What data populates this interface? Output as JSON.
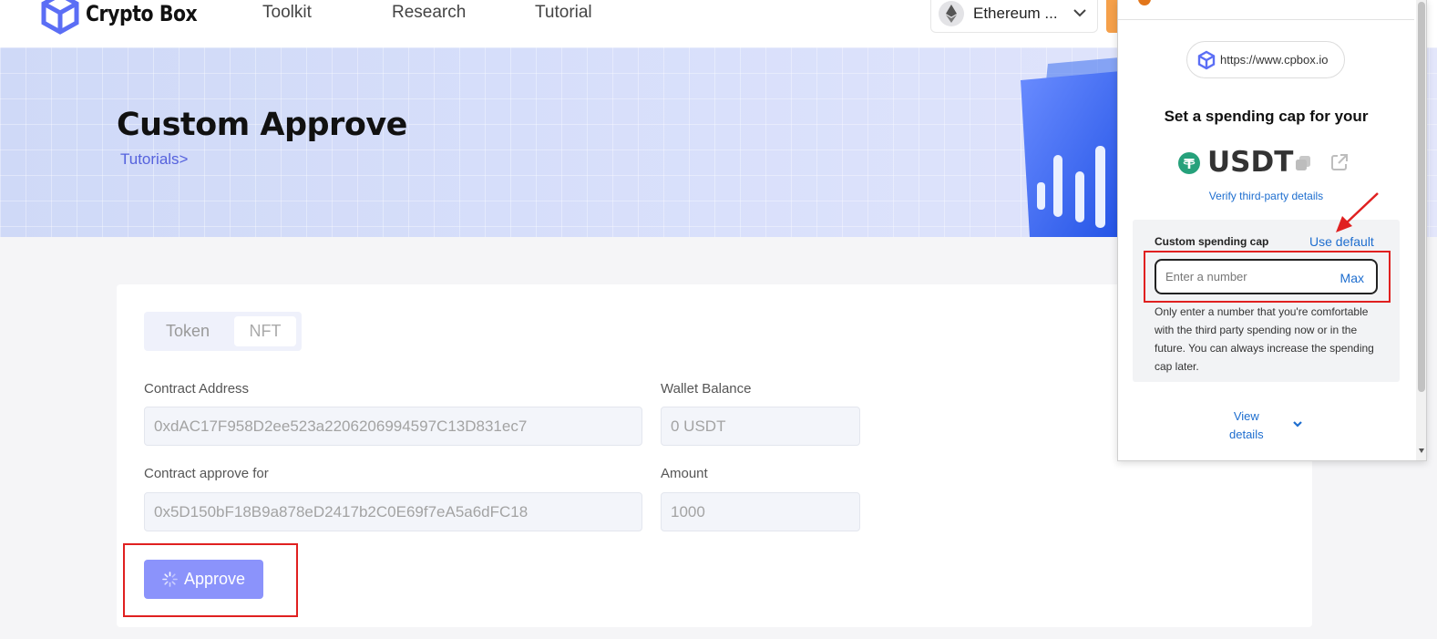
{
  "nav": {
    "brand": "Crypto Box",
    "links": [
      "Toolkit",
      "Research",
      "Tutorial"
    ],
    "network": "Ethereum ..."
  },
  "banner": {
    "title": "Custom Approve",
    "breadcrumb": "Tutorials>"
  },
  "form": {
    "tabs": [
      "Token",
      "NFT"
    ],
    "contract_address_label": "Contract Address",
    "contract_address_value": "0xdAC17F958D2ee523a2206206994597C13D831ec7",
    "wallet_balance_label": "Wallet Balance",
    "wallet_balance_value": "0 USDT",
    "approve_for_label": "Contract approve for",
    "approve_for_value": "0x5D150bF18B9a878eD2417b2C0E69f7eA5a6dFC18",
    "amount_label": "Amount",
    "amount_value": "1000",
    "approve_button": "Approve"
  },
  "wallet_popup": {
    "site_url": "https://www.cpbox.io",
    "heading": "Set a spending cap for your",
    "token_symbol": "USDT",
    "verify_link": "Verify third-party details",
    "cap_label": "Custom spending cap",
    "use_default": "Use default",
    "input_placeholder": "Enter a number",
    "max_label": "Max",
    "help_text": "Only enter a number that you're comfortable with the third party spending now or in the future. You can always increase the spending cap later.",
    "view_details_line1": "View",
    "view_details_line2": "details"
  },
  "colors": {
    "accent": "#8b93fb",
    "link": "#1e6ecf",
    "highlight": "#e02020",
    "tether": "#26a17b"
  }
}
